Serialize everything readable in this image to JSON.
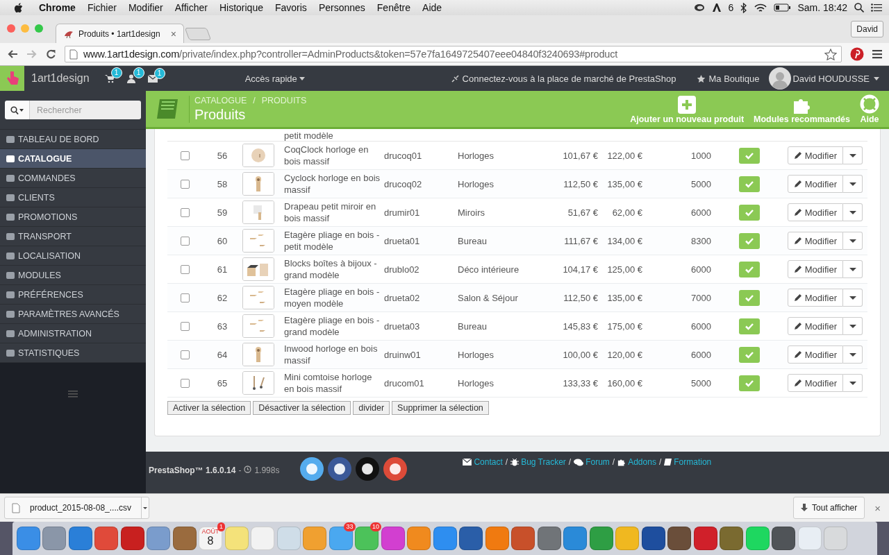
{
  "menubar": {
    "app": "Chrome",
    "items": [
      "Fichier",
      "Modifier",
      "Afficher",
      "Historique",
      "Favoris",
      "Personnes",
      "Fenêtre",
      "Aide"
    ],
    "adobe_count": "6",
    "clock": "Sam. 18:42"
  },
  "browser": {
    "tab_title": "Produits • 1art1design",
    "tab_close": "×",
    "profile": "David",
    "url_host": "www.1art1design.com",
    "url_path": "/private/index.php?controller=AdminProducts&token=57e7fa1649725407eee04840f3240693#product"
  },
  "topbar": {
    "shop": "1art1design",
    "badges": [
      {
        "kind": "cart",
        "count": "1"
      },
      {
        "kind": "user",
        "count": "1"
      },
      {
        "kind": "mail",
        "count": "1"
      }
    ],
    "quick_access": "Accès rapide",
    "marketplace": "Connectez-vous à la place de marché de PrestaShop",
    "my_shop": "Ma Boutique",
    "user": "David HOUDUSSE"
  },
  "sidebar": {
    "search_placeholder": "Rechercher",
    "items": [
      {
        "label": "TABLEAU DE BORD",
        "selected": false
      },
      {
        "label": "CATALOGUE",
        "selected": true
      },
      {
        "label": "COMMANDES",
        "selected": false
      },
      {
        "label": "CLIENTS",
        "selected": false
      },
      {
        "label": "PROMOTIONS",
        "selected": false
      },
      {
        "label": "TRANSPORT",
        "selected": false
      },
      {
        "label": "LOCALISATION",
        "selected": false
      },
      {
        "label": "MODULES",
        "selected": false
      },
      {
        "label": "PRÉFÉRENCES",
        "selected": false
      },
      {
        "label": "PARAMÈTRES AVANCÉS",
        "selected": false
      },
      {
        "label": "ADMINISTRATION",
        "selected": false
      },
      {
        "label": "STATISTIQUES",
        "selected": false
      }
    ]
  },
  "page_header": {
    "breadcrumb": [
      "CATALOGUE",
      "PRODUITS"
    ],
    "breadcrumb_separator": "/",
    "title": "Produits",
    "actions": [
      {
        "kind": "add",
        "label": "Ajouter un nouveau produit"
      },
      {
        "kind": "modules",
        "label": "Modules recommandés"
      },
      {
        "kind": "help",
        "label": "Aide"
      }
    ]
  },
  "table": {
    "partial_row_name": "petit modèle",
    "rows": [
      {
        "checked": false,
        "id": "56",
        "name": "CoqClock horloge en bois massif",
        "reference": "drucoq01",
        "category": "Horloges",
        "price_ht": "101,67 €",
        "price_ttc": "122,00 €",
        "quantity": "1000",
        "active": true,
        "edit_label": "Modifier"
      },
      {
        "checked": false,
        "id": "58",
        "name": "Cyclock horloge en bois massif",
        "reference": "drucoq02",
        "category": "Horloges",
        "price_ht": "112,50 €",
        "price_ttc": "135,00 €",
        "quantity": "5000",
        "active": true,
        "edit_label": "Modifier"
      },
      {
        "checked": false,
        "id": "59",
        "name": "Drapeau petit miroir en bois massif",
        "reference": "drumir01",
        "category": "Miroirs",
        "price_ht": "51,67 €",
        "price_ttc": "62,00 €",
        "quantity": "6000",
        "active": true,
        "edit_label": "Modifier"
      },
      {
        "checked": false,
        "id": "60",
        "name": "Etagère pliage en bois - petit modèle",
        "reference": "drueta01",
        "category": "Bureau",
        "price_ht": "111,67 €",
        "price_ttc": "134,00 €",
        "quantity": "8300",
        "active": true,
        "edit_label": "Modifier"
      },
      {
        "checked": false,
        "id": "61",
        "name": "Blocks boîtes à bijoux - grand modèle",
        "reference": "drublo02",
        "category": "Déco intérieure",
        "price_ht": "104,17 €",
        "price_ttc": "125,00 €",
        "quantity": "6000",
        "active": true,
        "edit_label": "Modifier"
      },
      {
        "checked": false,
        "id": "62",
        "name": "Etagère pliage en bois - moyen modèle",
        "reference": "drueta02",
        "category": "Salon & Séjour",
        "price_ht": "112,50 €",
        "price_ttc": "135,00 €",
        "quantity": "7000",
        "active": true,
        "edit_label": "Modifier"
      },
      {
        "checked": false,
        "id": "63",
        "name": "Etagère pliage en bois - grand modèle",
        "reference": "drueta03",
        "category": "Bureau",
        "price_ht": "145,83 €",
        "price_ttc": "175,00 €",
        "quantity": "6000",
        "active": true,
        "edit_label": "Modifier"
      },
      {
        "checked": false,
        "id": "64",
        "name": "Inwood horloge en bois massif",
        "reference": "druinw01",
        "category": "Horloges",
        "price_ht": "100,00 €",
        "price_ttc": "120,00 €",
        "quantity": "6000",
        "active": true,
        "edit_label": "Modifier"
      },
      {
        "checked": false,
        "id": "65",
        "name": "Mini comtoise horloge en bois massif",
        "reference": "drucom01",
        "category": "Horloges",
        "price_ht": "133,33 €",
        "price_ttc": "160,00 €",
        "quantity": "5000",
        "active": true,
        "edit_label": "Modifier"
      }
    ],
    "bulk_actions": [
      "Activer la sélection",
      "Désactiver la sélection",
      "divider",
      "Supprimer la sélection"
    ]
  },
  "footer": {
    "version": "PrestaShop™ 1.6.0.14",
    "dash": "-",
    "load_time": "1.998s",
    "social": [
      {
        "color": "#55acee"
      },
      {
        "color": "#3b5998"
      },
      {
        "color": "#111111"
      },
      {
        "color": "#dd4b39"
      }
    ],
    "links": [
      {
        "kind": "mail",
        "label": "Contact"
      },
      {
        "kind": "bug",
        "label": "Bug Tracker"
      },
      {
        "kind": "chat",
        "label": "Forum"
      },
      {
        "kind": "puzzle",
        "label": "Addons"
      },
      {
        "kind": "book",
        "label": "Formation"
      }
    ],
    "separator": "/"
  },
  "download_bar": {
    "file": "product_2015-08-08_....csv",
    "show_all": "Tout afficher",
    "close": "×"
  },
  "dock": [
    {
      "kind": "app",
      "color": "#3a8ee6"
    },
    {
      "kind": "app",
      "color": "#8a96a8"
    },
    {
      "kind": "app",
      "color": "#2a7fd8"
    },
    {
      "kind": "app",
      "color": "#e04a3a"
    },
    {
      "kind": "app",
      "color": "#c8201f"
    },
    {
      "kind": "app",
      "color": "#7a9ccc"
    },
    {
      "kind": "app",
      "color": "#9a6b3e"
    },
    {
      "kind": "calendar",
      "color": "#f4f4f4",
      "month": "AOÛT",
      "day": "8",
      "badge": "1"
    },
    {
      "kind": "app",
      "color": "#f4e27a"
    },
    {
      "kind": "app",
      "color": "#f2f2f2"
    },
    {
      "kind": "app",
      "color": "#cfdde8"
    },
    {
      "kind": "app",
      "color": "#f0a030"
    },
    {
      "kind": "app",
      "color": "#4aa8f0",
      "badge": "33"
    },
    {
      "kind": "app",
      "color": "#4cc25a",
      "badge": "10"
    },
    {
      "kind": "app",
      "color": "#d23fd0"
    },
    {
      "kind": "app",
      "color": "#f08a1e"
    },
    {
      "kind": "app",
      "color": "#2e8ef0"
    },
    {
      "kind": "app",
      "color": "#2a5ea8"
    },
    {
      "kind": "app",
      "color": "#f07a10"
    },
    {
      "kind": "app",
      "color": "#c8502a"
    },
    {
      "kind": "app",
      "color": "#707478"
    },
    {
      "kind": "app",
      "color": "#2a8ad8"
    },
    {
      "kind": "app",
      "color": "#2e9e44"
    },
    {
      "kind": "app",
      "color": "#f0b820"
    },
    {
      "kind": "app",
      "color": "#1e4e9e"
    },
    {
      "kind": "app",
      "color": "#6a4e3a"
    },
    {
      "kind": "app",
      "color": "#d0202a"
    },
    {
      "kind": "app",
      "color": "#7a6a30"
    },
    {
      "kind": "app",
      "color": "#1ed760"
    },
    {
      "kind": "app",
      "color": "#505458"
    },
    {
      "kind": "app",
      "color": "#e8eef4"
    },
    {
      "kind": "app",
      "color": "#d8dadc"
    }
  ]
}
